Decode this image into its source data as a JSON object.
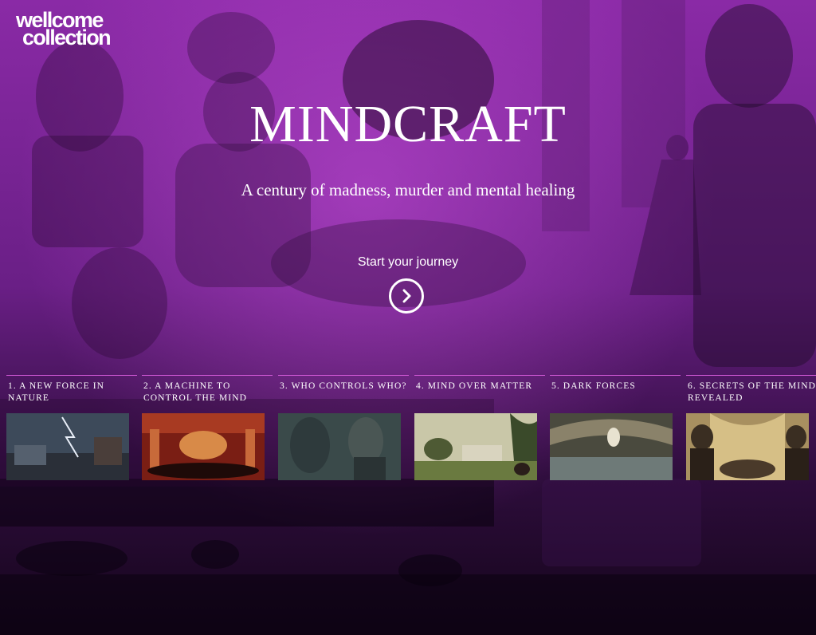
{
  "brand": {
    "line1": "wellcome",
    "line2": "collection"
  },
  "hero": {
    "title": "MINDCRAFT",
    "subtitle": "A century of madness, murder and mental healing",
    "cta_label": "Start your journey",
    "cta_icon": "chevron-right-icon"
  },
  "chapters": [
    {
      "label": "1. A new force in nature"
    },
    {
      "label": "2. A machine to control the mind"
    },
    {
      "label": "3. Who controls who?"
    },
    {
      "label": "4. Mind over matter"
    },
    {
      "label": "5. Dark forces"
    },
    {
      "label": "6. Secrets of the mind revealed"
    }
  ],
  "colors": {
    "accent": "#d35ad8",
    "background": "#7a259a",
    "dark": "#14051a"
  }
}
